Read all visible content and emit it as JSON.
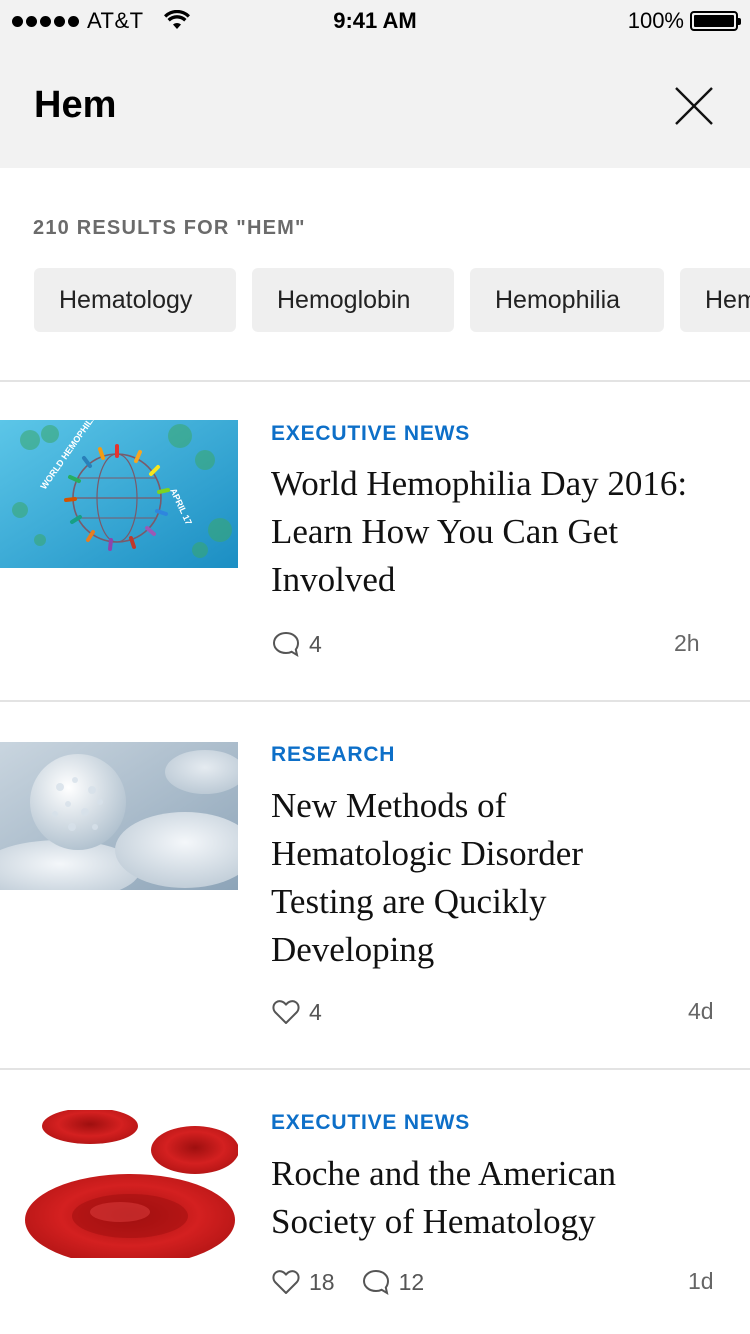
{
  "status_bar": {
    "carrier": "AT&T",
    "time": "9:41 AM",
    "battery": "100%"
  },
  "search": {
    "query": "Hem"
  },
  "results": {
    "count_label": "210 RESULTS FOR \"HEM\"",
    "chips": [
      "Hematology",
      "Hemoglobin",
      "Hemophilia",
      "Hem"
    ]
  },
  "articles": [
    {
      "category": "EXECUTIVE NEWS",
      "headline": "World Hemophilia Day 2016: Learn How You Can Get Involved",
      "comments": "4",
      "age": "2h",
      "thumb_labels": [
        "WORLD HEMOPHILIA DAY",
        "APRIL 17"
      ]
    },
    {
      "category": "RESEARCH",
      "headline": "New Methods of Hematologic Disorder Testing are Qucikly Developing",
      "likes": "4",
      "age": "4d"
    },
    {
      "category": "EXECUTIVE NEWS",
      "headline": "Roche and the American Society of Hematology",
      "likes": "18",
      "comments": "12",
      "age": "1d"
    }
  ],
  "colors": {
    "accent": "#0d6fc8",
    "header_bg": "#f2f2f2",
    "chip_bg": "#efefef"
  }
}
